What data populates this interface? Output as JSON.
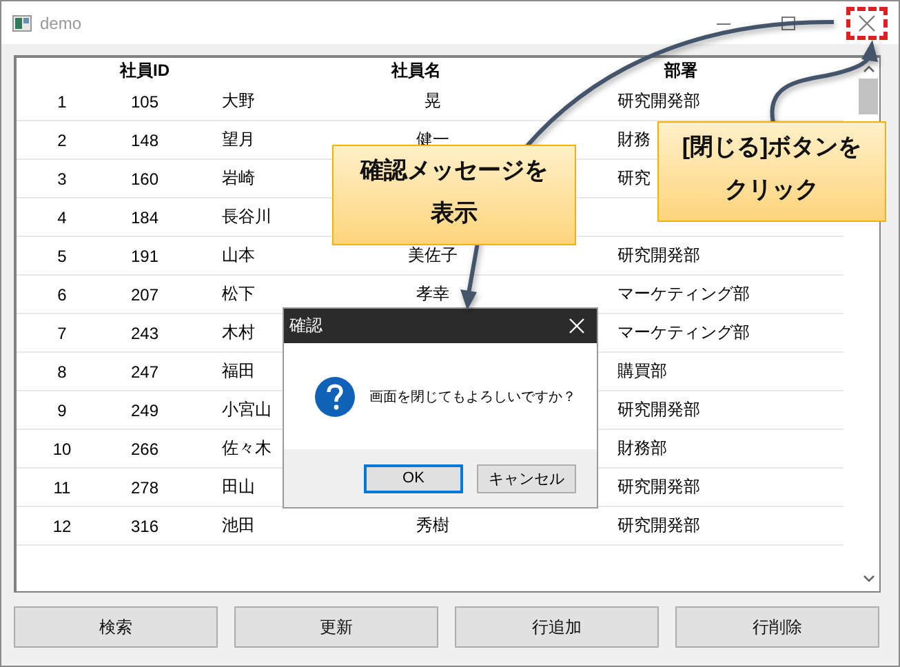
{
  "window": {
    "title": "demo",
    "close_highlighted": true
  },
  "table": {
    "columns": [
      "社員ID",
      "社員名",
      "部署"
    ],
    "rows": [
      {
        "no": "1",
        "id": "105",
        "last_name": "大野",
        "first_name": "晃",
        "department": "研究開発部"
      },
      {
        "no": "2",
        "id": "148",
        "last_name": "望月",
        "first_name": "健一",
        "department": "財務"
      },
      {
        "no": "3",
        "id": "160",
        "last_name": "岩崎",
        "department": "研究"
      },
      {
        "no": "4",
        "id": "184",
        "last_name": "長谷川"
      },
      {
        "no": "5",
        "id": "191",
        "last_name": "山本",
        "first_name": "美佐子",
        "department": "研究開発部"
      },
      {
        "no": "6",
        "id": "207",
        "last_name": "松下",
        "first_name": "孝幸",
        "department": "マーケティング部"
      },
      {
        "no": "7",
        "id": "243",
        "last_name": "木村",
        "department": "マーケティング部"
      },
      {
        "no": "8",
        "id": "247",
        "last_name": "福田",
        "department": "購買部"
      },
      {
        "no": "9",
        "id": "249",
        "last_name": "小宮山",
        "department": "研究開発部"
      },
      {
        "no": "10",
        "id": "266",
        "last_name": "佐々木",
        "department": "財務部"
      },
      {
        "no": "11",
        "id": "278",
        "last_name": "田山",
        "department": "研究開発部"
      },
      {
        "no": "12",
        "id": "316",
        "last_name": "池田",
        "first_name": "秀樹",
        "department": "研究開発部"
      }
    ]
  },
  "buttons": [
    "検索",
    "更新",
    "行追加",
    "行削除"
  ],
  "dialog": {
    "title": "確認",
    "message": "画面を閉じてもよろしいですか？",
    "buttons": [
      {
        "label": "OK",
        "default": true
      },
      {
        "label": "キャンセル",
        "default": false
      }
    ]
  },
  "callouts": [
    {
      "lines": [
        "確認メッセージを",
        "表示"
      ]
    },
    {
      "lines": [
        "[閉じる]ボタンを",
        "クリック"
      ]
    }
  ]
}
